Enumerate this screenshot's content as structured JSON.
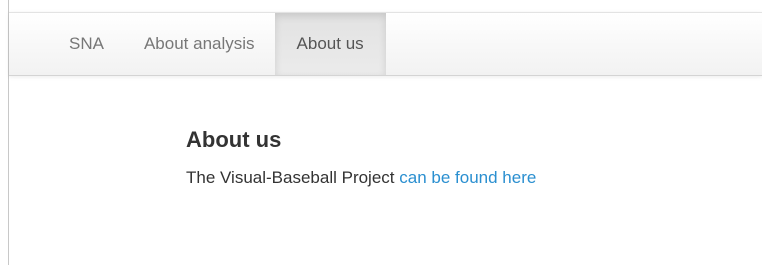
{
  "navbar": {
    "items": [
      {
        "label": "SNA",
        "active": false
      },
      {
        "label": "About analysis",
        "active": false
      },
      {
        "label": "About us",
        "active": true
      }
    ]
  },
  "main": {
    "title": "About us",
    "text_before_link": "The Visual-Baseball Project",
    "link_text": "can be found here"
  },
  "colors": {
    "link": "#2a8fd0",
    "text": "#333333",
    "nav_text": "#777777",
    "nav_active_bg": "#e5e5e5"
  }
}
